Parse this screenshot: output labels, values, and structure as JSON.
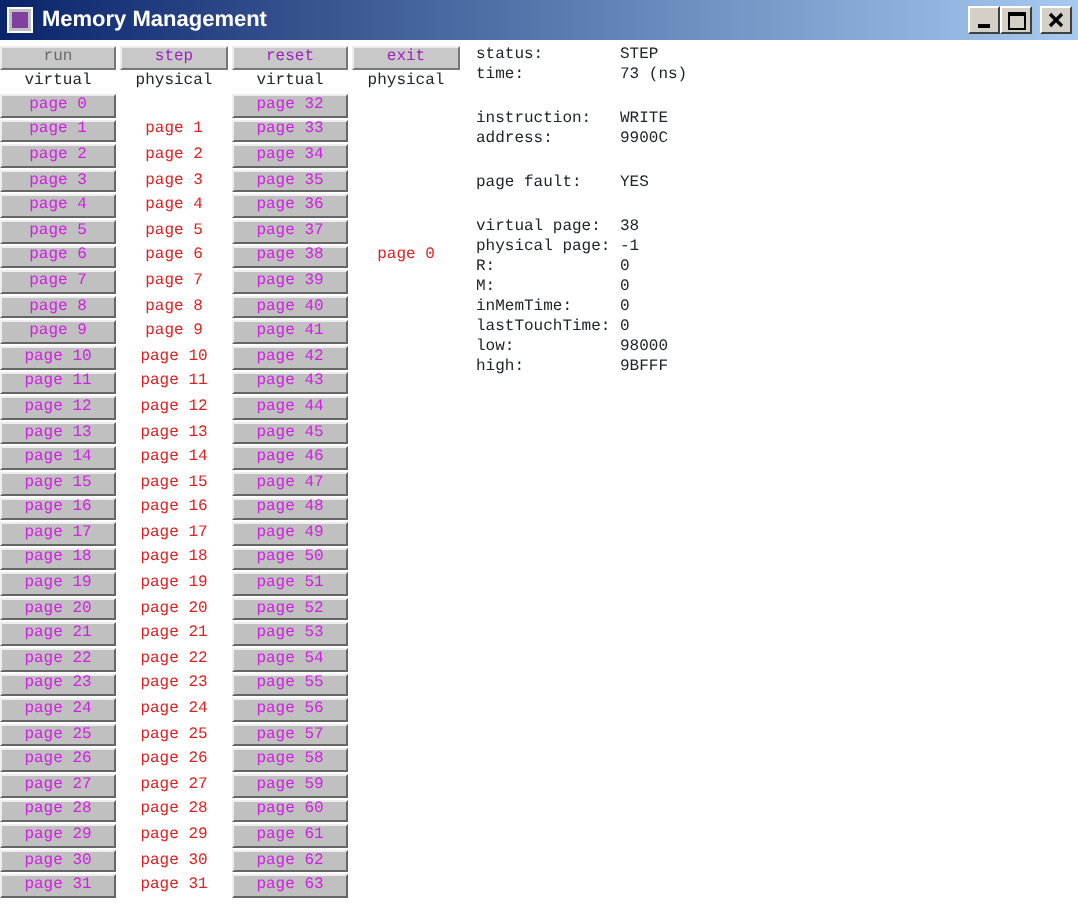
{
  "window": {
    "title": "Memory Management"
  },
  "buttons": [
    {
      "label": "run",
      "disabled": true
    },
    {
      "label": "step",
      "disabled": false
    },
    {
      "label": "reset",
      "disabled": false
    },
    {
      "label": "exit",
      "disabled": false
    }
  ],
  "column_headers": [
    "virtual",
    "physical",
    "virtual",
    "physical"
  ],
  "left_pages": [
    {
      "virtual": "page 0"
    },
    {
      "virtual": "page 1",
      "physical": "page 1"
    },
    {
      "virtual": "page 2",
      "physical": "page 2"
    },
    {
      "virtual": "page 3",
      "physical": "page 3"
    },
    {
      "virtual": "page 4",
      "physical": "page 4"
    },
    {
      "virtual": "page 5",
      "physical": "page 5"
    },
    {
      "virtual": "page 6",
      "physical": "page 6"
    },
    {
      "virtual": "page 7",
      "physical": "page 7"
    },
    {
      "virtual": "page 8",
      "physical": "page 8"
    },
    {
      "virtual": "page 9",
      "physical": "page 9"
    },
    {
      "virtual": "page 10",
      "physical": "page 10"
    },
    {
      "virtual": "page 11",
      "physical": "page 11"
    },
    {
      "virtual": "page 12",
      "physical": "page 12"
    },
    {
      "virtual": "page 13",
      "physical": "page 13"
    },
    {
      "virtual": "page 14",
      "physical": "page 14"
    },
    {
      "virtual": "page 15",
      "physical": "page 15"
    },
    {
      "virtual": "page 16",
      "physical": "page 16"
    },
    {
      "virtual": "page 17",
      "physical": "page 17"
    },
    {
      "virtual": "page 18",
      "physical": "page 18"
    },
    {
      "virtual": "page 19",
      "physical": "page 19"
    },
    {
      "virtual": "page 20",
      "physical": "page 20"
    },
    {
      "virtual": "page 21",
      "physical": "page 21"
    },
    {
      "virtual": "page 22",
      "physical": "page 22"
    },
    {
      "virtual": "page 23",
      "physical": "page 23"
    },
    {
      "virtual": "page 24",
      "physical": "page 24"
    },
    {
      "virtual": "page 25",
      "physical": "page 25"
    },
    {
      "virtual": "page 26",
      "physical": "page 26"
    },
    {
      "virtual": "page 27",
      "physical": "page 27"
    },
    {
      "virtual": "page 28",
      "physical": "page 28"
    },
    {
      "virtual": "page 29",
      "physical": "page 29"
    },
    {
      "virtual": "page 30",
      "physical": "page 30"
    },
    {
      "virtual": "page 31",
      "physical": "page 31"
    }
  ],
  "right_pages": [
    {
      "virtual": "page 32"
    },
    {
      "virtual": "page 33"
    },
    {
      "virtual": "page 34"
    },
    {
      "virtual": "page 35"
    },
    {
      "virtual": "page 36"
    },
    {
      "virtual": "page 37"
    },
    {
      "virtual": "page 38",
      "physical": "page 0"
    },
    {
      "virtual": "page 39"
    },
    {
      "virtual": "page 40"
    },
    {
      "virtual": "page 41"
    },
    {
      "virtual": "page 42"
    },
    {
      "virtual": "page 43"
    },
    {
      "virtual": "page 44"
    },
    {
      "virtual": "page 45"
    },
    {
      "virtual": "page 46"
    },
    {
      "virtual": "page 47"
    },
    {
      "virtual": "page 48"
    },
    {
      "virtual": "page 49"
    },
    {
      "virtual": "page 50"
    },
    {
      "virtual": "page 51"
    },
    {
      "virtual": "page 52"
    },
    {
      "virtual": "page 53"
    },
    {
      "virtual": "page 54"
    },
    {
      "virtual": "page 55"
    },
    {
      "virtual": "page 56"
    },
    {
      "virtual": "page 57"
    },
    {
      "virtual": "page 58"
    },
    {
      "virtual": "page 59"
    },
    {
      "virtual": "page 60"
    },
    {
      "virtual": "page 61"
    },
    {
      "virtual": "page 62"
    },
    {
      "virtual": "page 63"
    }
  ],
  "info_sections": [
    [
      {
        "label": "status:",
        "value": "STEP"
      },
      {
        "label": "time:",
        "value": "73 (ns)"
      }
    ],
    [
      {
        "label": "instruction:",
        "value": "WRITE"
      },
      {
        "label": "address:",
        "value": "9900C"
      }
    ],
    [
      {
        "label": "page fault:",
        "value": "YES"
      }
    ],
    [
      {
        "label": "virtual page:",
        "value": "38"
      },
      {
        "label": "physical page:",
        "value": "-1"
      },
      {
        "label": "R:",
        "value": "0"
      },
      {
        "label": "M:",
        "value": "0"
      },
      {
        "label": "inMemTime:",
        "value": "0"
      },
      {
        "label": "lastTouchTime:",
        "value": "0"
      },
      {
        "label": "low:",
        "value": "98000"
      },
      {
        "label": "high:",
        "value": "9BFFF"
      }
    ]
  ]
}
